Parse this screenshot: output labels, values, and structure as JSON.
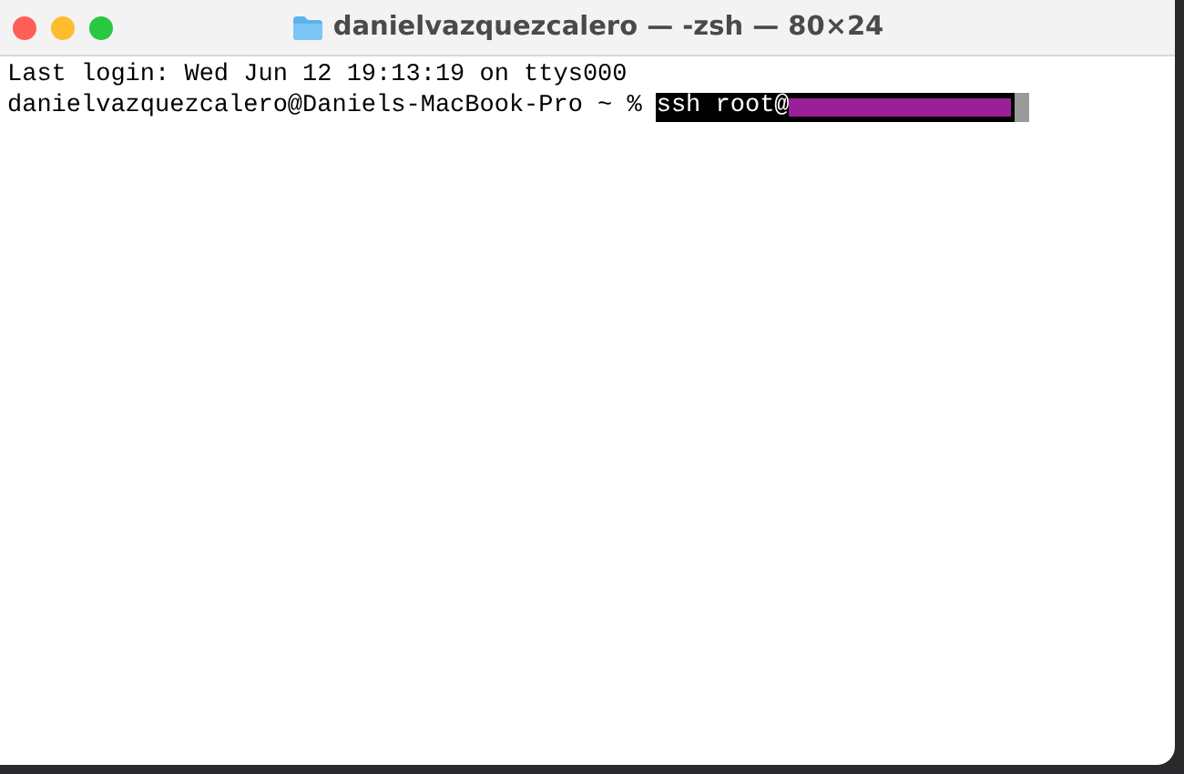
{
  "window": {
    "title": "danielvazquezcalero — -zsh — 80×24"
  },
  "terminal": {
    "lines": [
      {
        "text": "Last login: Wed Jun 12 19:13:19 on ttys000"
      }
    ],
    "prompt": "danielvazquezcalero@Daniels-MacBook-Pro ~ %",
    "command": {
      "text": "ssh root@",
      "selected": true,
      "redacted": true
    }
  }
}
